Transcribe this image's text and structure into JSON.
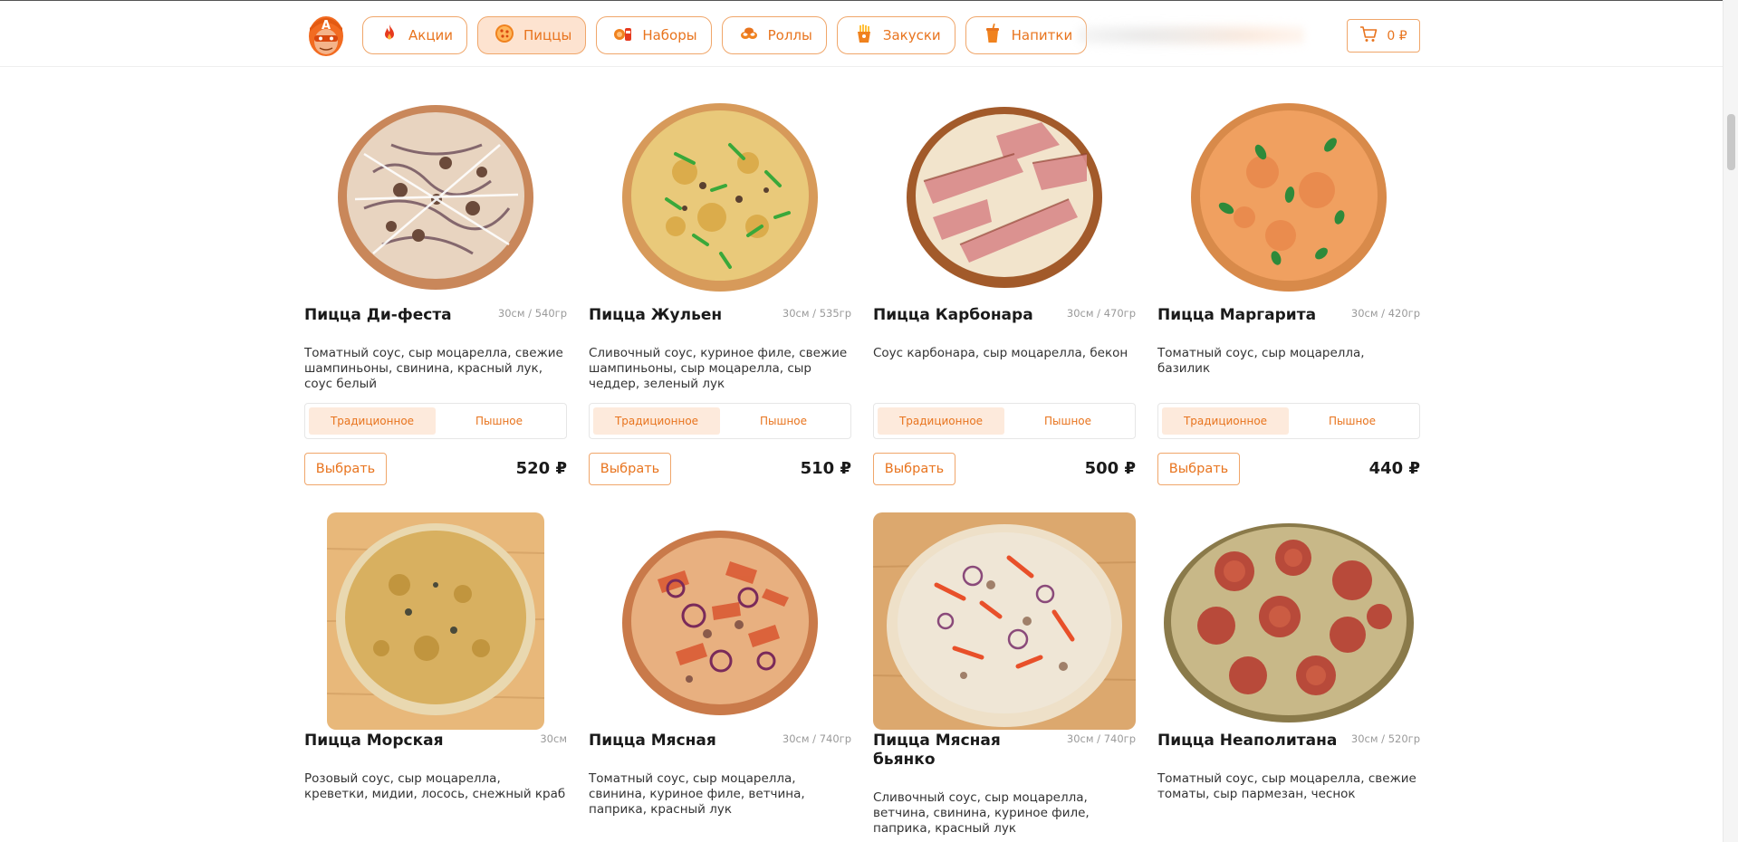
{
  "nav": {
    "items": [
      {
        "label": "Акции",
        "icon": "fire-icon",
        "active": false
      },
      {
        "label": "Пиццы",
        "icon": "pizza-icon",
        "active": true
      },
      {
        "label": "Наборы",
        "icon": "set-icon",
        "active": false
      },
      {
        "label": "Роллы",
        "icon": "rolls-icon",
        "active": false
      },
      {
        "label": "Закуски",
        "icon": "fries-icon",
        "active": false
      },
      {
        "label": "Напитки",
        "icon": "drink-icon",
        "active": false
      }
    ]
  },
  "cart": {
    "label": "0 ₽",
    "icon": "cart-icon"
  },
  "colors": {
    "accent": "#e8741e",
    "accent_border": "#f0a66a",
    "active_bg": "#fde3d0"
  },
  "variants": {
    "traditional": "Традиционное",
    "fluffy": "Пышное"
  },
  "choose_label": "Выбрать",
  "products": [
    {
      "title": "Пицца Ди-феста",
      "weight": "30см / 540гр",
      "description": "Томатный соус, сыр моцарелла, свежие шампиньоны, свинина, красный лук, соус белый",
      "price": "520 ₽"
    },
    {
      "title": "Пицца Жульен",
      "weight": "30см / 535гр",
      "description": "Сливочный соус, куриное филе, свежие шампиньоны, сыр моцарелла, сыр чеддер, зеленый лук",
      "price": "510 ₽"
    },
    {
      "title": "Пицца Карбонара",
      "weight": "30см / 470гр",
      "description": "Соус карбонара, сыр моцарелла, бекон",
      "price": "500 ₽"
    },
    {
      "title": "Пицца Маргарита",
      "weight": "30см / 420гр",
      "description": "Томатный соус, сыр моцарелла, базилик",
      "price": "440 ₽"
    },
    {
      "title": "Пицца Морская",
      "weight": "30см",
      "description": "Розовый соус, сыр моцарелла, креветки, мидии, лосось, снежный краб"
    },
    {
      "title": "Пицца Мясная",
      "weight": "30см / 740гр",
      "description": "Томатный соус, сыр моцарелла, свинина, куриное филе, ветчина, паприка, красный лук"
    },
    {
      "title": "Пицца Мясная бьянко",
      "weight": "30см / 740гр",
      "description": "Сливочный соус, сыр моцарелла, ветчина, свинина, куриное филе, паприка, красный лук"
    },
    {
      "title": "Пицца Неаполитана",
      "weight": "30см / 520гр",
      "description": "Томатный соус, сыр моцарелла, свежие томаты, сыр пармезан, чеснок"
    }
  ]
}
